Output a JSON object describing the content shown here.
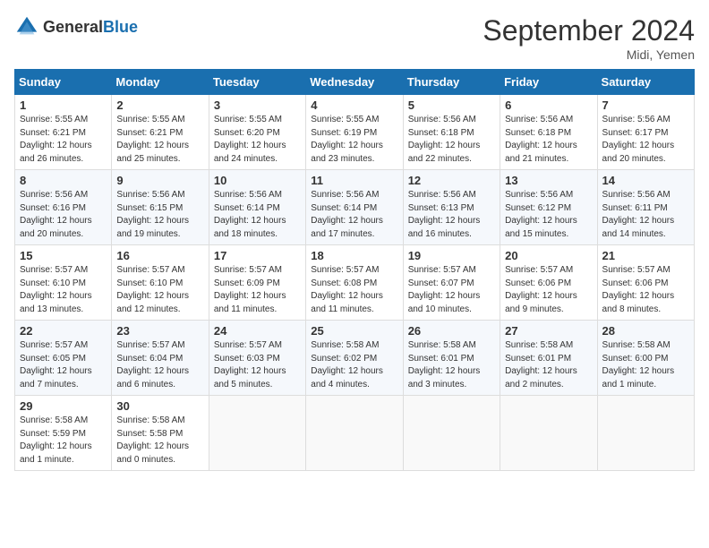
{
  "header": {
    "logo_general": "General",
    "logo_blue": "Blue",
    "month_title": "September 2024",
    "location": "Midi, Yemen"
  },
  "weekdays": [
    "Sunday",
    "Monday",
    "Tuesday",
    "Wednesday",
    "Thursday",
    "Friday",
    "Saturday"
  ],
  "weeks": [
    [
      {
        "day": "1",
        "sunrise": "5:55 AM",
        "sunset": "6:21 PM",
        "daylight": "12 hours and 26 minutes."
      },
      {
        "day": "2",
        "sunrise": "5:55 AM",
        "sunset": "6:21 PM",
        "daylight": "12 hours and 25 minutes."
      },
      {
        "day": "3",
        "sunrise": "5:55 AM",
        "sunset": "6:20 PM",
        "daylight": "12 hours and 24 minutes."
      },
      {
        "day": "4",
        "sunrise": "5:55 AM",
        "sunset": "6:19 PM",
        "daylight": "12 hours and 23 minutes."
      },
      {
        "day": "5",
        "sunrise": "5:56 AM",
        "sunset": "6:18 PM",
        "daylight": "12 hours and 22 minutes."
      },
      {
        "day": "6",
        "sunrise": "5:56 AM",
        "sunset": "6:18 PM",
        "daylight": "12 hours and 21 minutes."
      },
      {
        "day": "7",
        "sunrise": "5:56 AM",
        "sunset": "6:17 PM",
        "daylight": "12 hours and 20 minutes."
      }
    ],
    [
      {
        "day": "8",
        "sunrise": "5:56 AM",
        "sunset": "6:16 PM",
        "daylight": "12 hours and 20 minutes."
      },
      {
        "day": "9",
        "sunrise": "5:56 AM",
        "sunset": "6:15 PM",
        "daylight": "12 hours and 19 minutes."
      },
      {
        "day": "10",
        "sunrise": "5:56 AM",
        "sunset": "6:14 PM",
        "daylight": "12 hours and 18 minutes."
      },
      {
        "day": "11",
        "sunrise": "5:56 AM",
        "sunset": "6:14 PM",
        "daylight": "12 hours and 17 minutes."
      },
      {
        "day": "12",
        "sunrise": "5:56 AM",
        "sunset": "6:13 PM",
        "daylight": "12 hours and 16 minutes."
      },
      {
        "day": "13",
        "sunrise": "5:56 AM",
        "sunset": "6:12 PM",
        "daylight": "12 hours and 15 minutes."
      },
      {
        "day": "14",
        "sunrise": "5:56 AM",
        "sunset": "6:11 PM",
        "daylight": "12 hours and 14 minutes."
      }
    ],
    [
      {
        "day": "15",
        "sunrise": "5:57 AM",
        "sunset": "6:10 PM",
        "daylight": "12 hours and 13 minutes."
      },
      {
        "day": "16",
        "sunrise": "5:57 AM",
        "sunset": "6:10 PM",
        "daylight": "12 hours and 12 minutes."
      },
      {
        "day": "17",
        "sunrise": "5:57 AM",
        "sunset": "6:09 PM",
        "daylight": "12 hours and 11 minutes."
      },
      {
        "day": "18",
        "sunrise": "5:57 AM",
        "sunset": "6:08 PM",
        "daylight": "12 hours and 11 minutes."
      },
      {
        "day": "19",
        "sunrise": "5:57 AM",
        "sunset": "6:07 PM",
        "daylight": "12 hours and 10 minutes."
      },
      {
        "day": "20",
        "sunrise": "5:57 AM",
        "sunset": "6:06 PM",
        "daylight": "12 hours and 9 minutes."
      },
      {
        "day": "21",
        "sunrise": "5:57 AM",
        "sunset": "6:06 PM",
        "daylight": "12 hours and 8 minutes."
      }
    ],
    [
      {
        "day": "22",
        "sunrise": "5:57 AM",
        "sunset": "6:05 PM",
        "daylight": "12 hours and 7 minutes."
      },
      {
        "day": "23",
        "sunrise": "5:57 AM",
        "sunset": "6:04 PM",
        "daylight": "12 hours and 6 minutes."
      },
      {
        "day": "24",
        "sunrise": "5:57 AM",
        "sunset": "6:03 PM",
        "daylight": "12 hours and 5 minutes."
      },
      {
        "day": "25",
        "sunrise": "5:58 AM",
        "sunset": "6:02 PM",
        "daylight": "12 hours and 4 minutes."
      },
      {
        "day": "26",
        "sunrise": "5:58 AM",
        "sunset": "6:01 PM",
        "daylight": "12 hours and 3 minutes."
      },
      {
        "day": "27",
        "sunrise": "5:58 AM",
        "sunset": "6:01 PM",
        "daylight": "12 hours and 2 minutes."
      },
      {
        "day": "28",
        "sunrise": "5:58 AM",
        "sunset": "6:00 PM",
        "daylight": "12 hours and 1 minute."
      }
    ],
    [
      {
        "day": "29",
        "sunrise": "5:58 AM",
        "sunset": "5:59 PM",
        "daylight": "12 hours and 1 minute."
      },
      {
        "day": "30",
        "sunrise": "5:58 AM",
        "sunset": "5:58 PM",
        "daylight": "12 hours and 0 minutes."
      },
      null,
      null,
      null,
      null,
      null
    ]
  ]
}
